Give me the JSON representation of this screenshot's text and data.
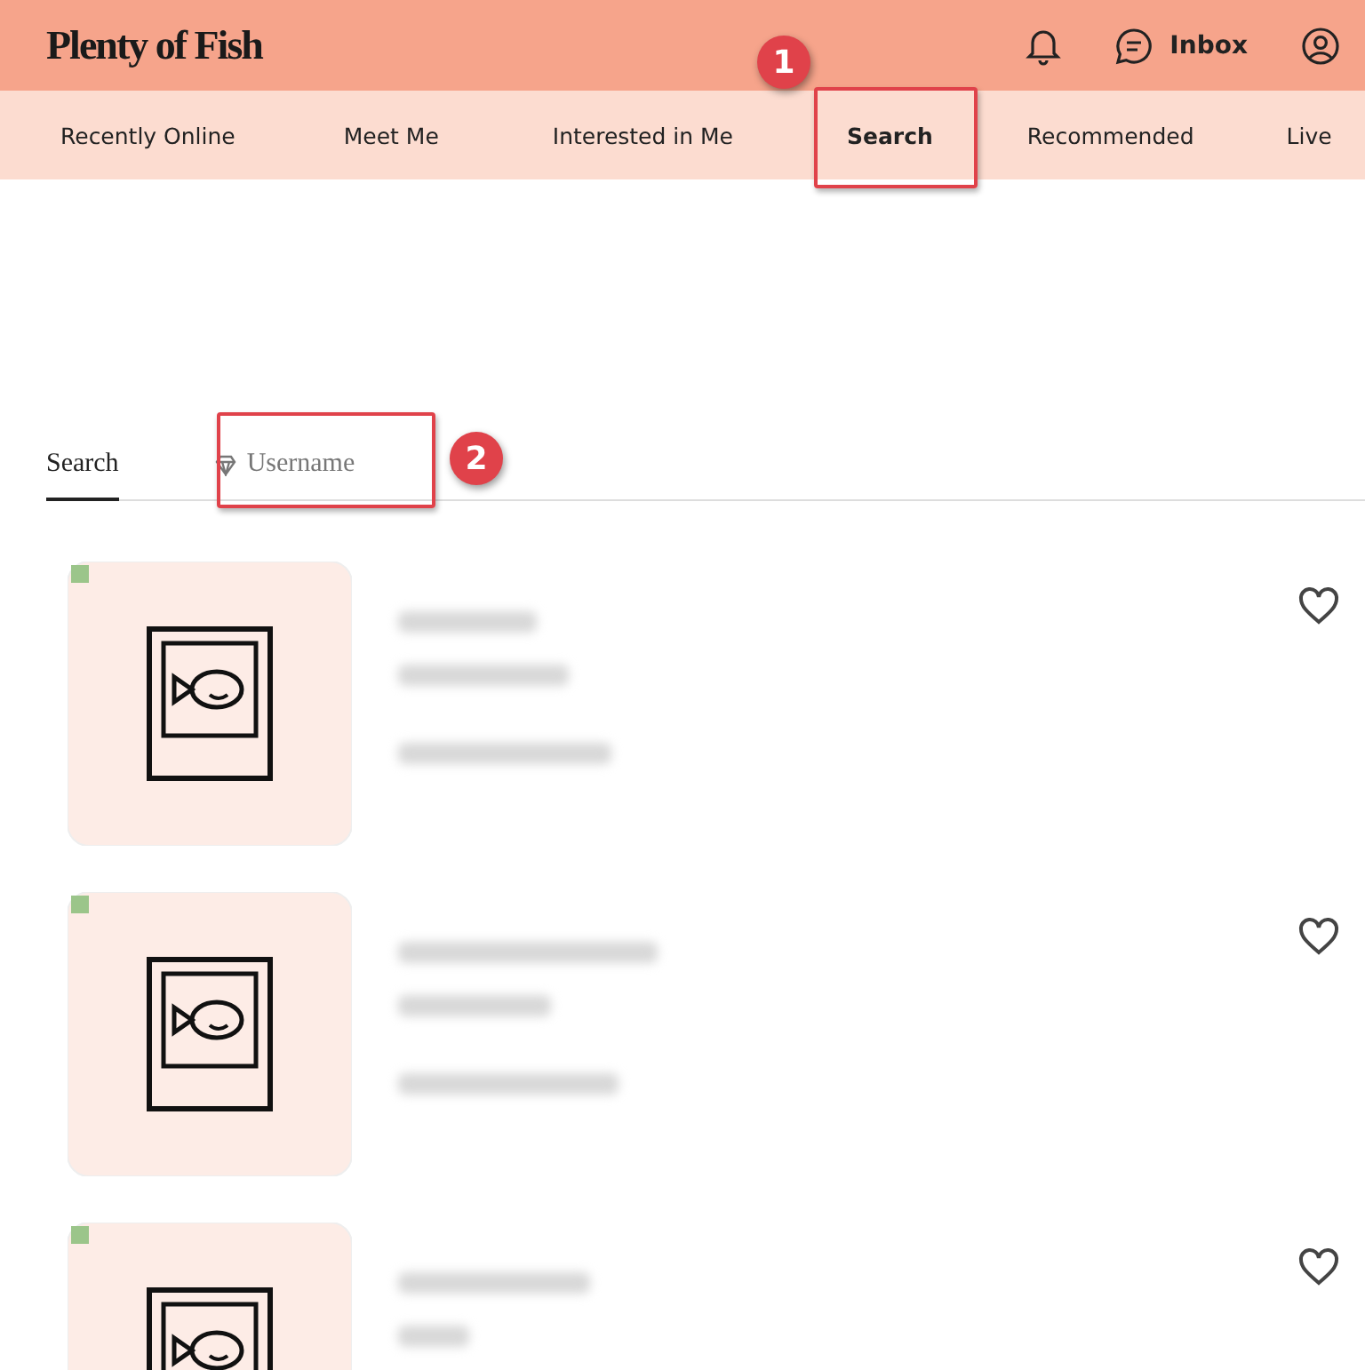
{
  "header": {
    "logo": "Plenty of Fish",
    "inbox": "Inbox"
  },
  "nav": [
    {
      "label": "Recently Online",
      "selected": false
    },
    {
      "label": "Meet Me",
      "selected": false
    },
    {
      "label": "Interested in Me",
      "selected": false
    },
    {
      "label": "Search",
      "selected": true
    },
    {
      "label": "Recommended",
      "selected": false
    },
    {
      "label": "Live",
      "selected": false
    }
  ],
  "subtabs": [
    {
      "label": "Search",
      "selected": true,
      "kind": "plain"
    },
    {
      "label": "Username",
      "selected": false,
      "kind": "premium"
    }
  ],
  "callouts": [
    "1",
    "2"
  ],
  "profiles": [
    {
      "favorited": false
    },
    {
      "favorited": false
    },
    {
      "favorited": false
    }
  ]
}
